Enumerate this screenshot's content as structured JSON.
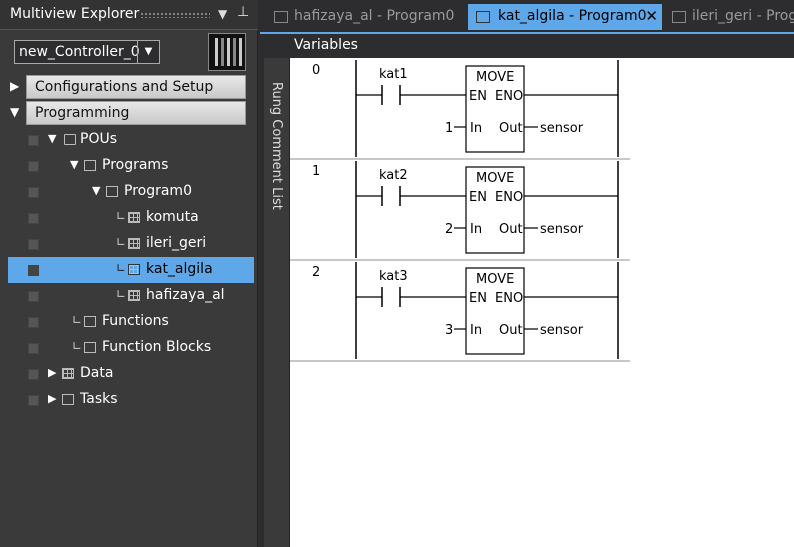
{
  "explorer": {
    "title": "Multiview Explorer",
    "controller": {
      "selected": "new_Controller_0"
    },
    "sections": [
      {
        "label": "Configurations and Setup",
        "expanded": false
      },
      {
        "label": "Programming",
        "expanded": true
      }
    ],
    "tree": [
      {
        "label": "POUs",
        "icon": "document-icon"
      },
      {
        "label": "Programs",
        "icon": "programs-icon"
      },
      {
        "label": "Program0",
        "icon": "program-icon"
      },
      {
        "label": "komuta",
        "icon": "section-icon"
      },
      {
        "label": "ileri_geri",
        "icon": "section-icon"
      },
      {
        "label": "kat_algila",
        "icon": "section-icon",
        "selected": true
      },
      {
        "label": "hafizaya_al",
        "icon": "section-icon"
      },
      {
        "label": "Functions",
        "icon": "functions-icon"
      },
      {
        "label": "Function Blocks",
        "icon": "function-blocks-icon"
      },
      {
        "label": "Data",
        "icon": "data-icon"
      },
      {
        "label": "Tasks",
        "icon": "tasks-icon"
      }
    ]
  },
  "tabs": [
    {
      "label": "hafizaya_al - Program0",
      "active": false
    },
    {
      "label": "kat_algila - Program0",
      "active": true,
      "close": "✕"
    },
    {
      "label": "ileri_geri - Prog",
      "active": false
    }
  ],
  "variables_label": "Variables",
  "rung_comment_label": "Rung Comment List",
  "rungs": [
    {
      "number": "0",
      "contact": "kat1",
      "block": "MOVE",
      "en": "EN",
      "eno": "ENO",
      "in_label": "In",
      "out_label": "Out",
      "in_value": "1",
      "out_value": "sensor"
    },
    {
      "number": "1",
      "contact": "kat2",
      "block": "MOVE",
      "en": "EN",
      "eno": "ENO",
      "in_label": "In",
      "out_label": "Out",
      "in_value": "2",
      "out_value": "sensor"
    },
    {
      "number": "2",
      "contact": "kat3",
      "block": "MOVE",
      "en": "EN",
      "eno": "ENO",
      "in_label": "In",
      "out_label": "Out",
      "in_value": "3",
      "out_value": "sensor"
    }
  ],
  "colors": {
    "accent": "#5ea7e8",
    "panel": "#3a3a3a",
    "background": "#2d2d30"
  }
}
